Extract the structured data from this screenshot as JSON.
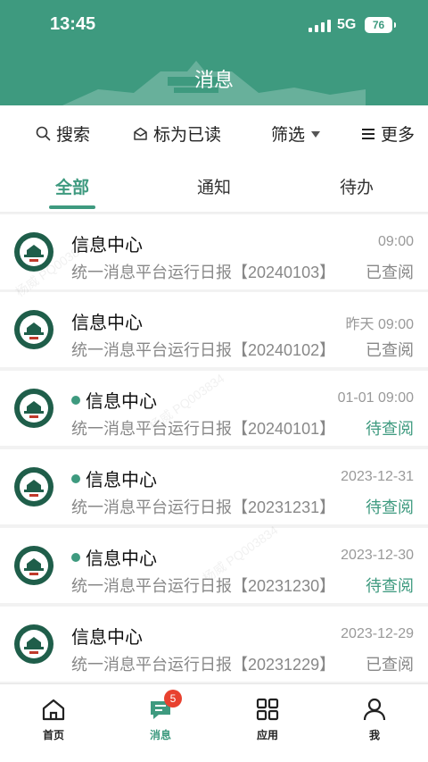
{
  "status_bar": {
    "time": "13:45",
    "network": "5G",
    "battery": "76"
  },
  "header": {
    "title": "消息"
  },
  "toolbar": {
    "search": "搜索",
    "mark_read": "标为已读",
    "filter": "筛选",
    "more": "更多"
  },
  "tabs": [
    {
      "label": "全部",
      "active": true
    },
    {
      "label": "通知",
      "active": false
    },
    {
      "label": "待办",
      "active": false
    }
  ],
  "messages": [
    {
      "sender": "信息中心",
      "date": "09:00",
      "subject": "统一消息平台运行日报【20240103】",
      "status": "已查阅",
      "unread": false
    },
    {
      "sender": "信息中心",
      "date": "昨天 09:00",
      "subject": "统一消息平台运行日报【20240102】",
      "status": "已查阅",
      "unread": false
    },
    {
      "sender": "信息中心",
      "date": "01-01 09:00",
      "subject": "统一消息平台运行日报【20240101】",
      "status": "待查阅",
      "unread": true
    },
    {
      "sender": "信息中心",
      "date": "2023-12-31",
      "subject": "统一消息平台运行日报【20231231】",
      "status": "待查阅",
      "unread": true
    },
    {
      "sender": "信息中心",
      "date": "2023-12-30",
      "subject": "统一消息平台运行日报【20231230】",
      "status": "待查阅",
      "unread": true
    },
    {
      "sender": "信息中心",
      "date": "2023-12-29",
      "subject": "统一消息平台运行日报【20231229】",
      "status": "已查阅",
      "unread": false
    }
  ],
  "watermarks": [
    "杨威 PQ003834",
    "杨威 PQ003834",
    "杨威 PQ003834"
  ],
  "bottom_nav": [
    {
      "label": "首页",
      "icon": "home-icon",
      "active": false
    },
    {
      "label": "消息",
      "icon": "message-icon",
      "active": true,
      "badge": "5"
    },
    {
      "label": "应用",
      "icon": "apps-grid-icon",
      "active": false
    },
    {
      "label": "我",
      "icon": "user-icon",
      "active": false
    }
  ],
  "colors": {
    "primary": "#3e9a7f",
    "badge": "#e8412f",
    "pending": "#3e9a7f"
  }
}
